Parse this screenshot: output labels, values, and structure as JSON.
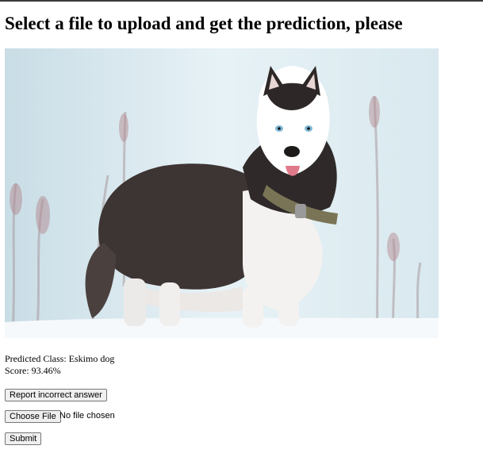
{
  "header": {
    "title": "Select a file to upload and get the prediction, please"
  },
  "image": {
    "alt": "Siberian husky standing in snow",
    "background_color": "#dbeaf0"
  },
  "result": {
    "predicted_class_label": "Predicted Class: Eskimo dog",
    "score_label": "Score: 93.46%"
  },
  "actions": {
    "report_label": "Report incorrect answer",
    "choose_file_label": "Choose File",
    "file_status": "No file chosen",
    "submit_label": "Submit"
  }
}
